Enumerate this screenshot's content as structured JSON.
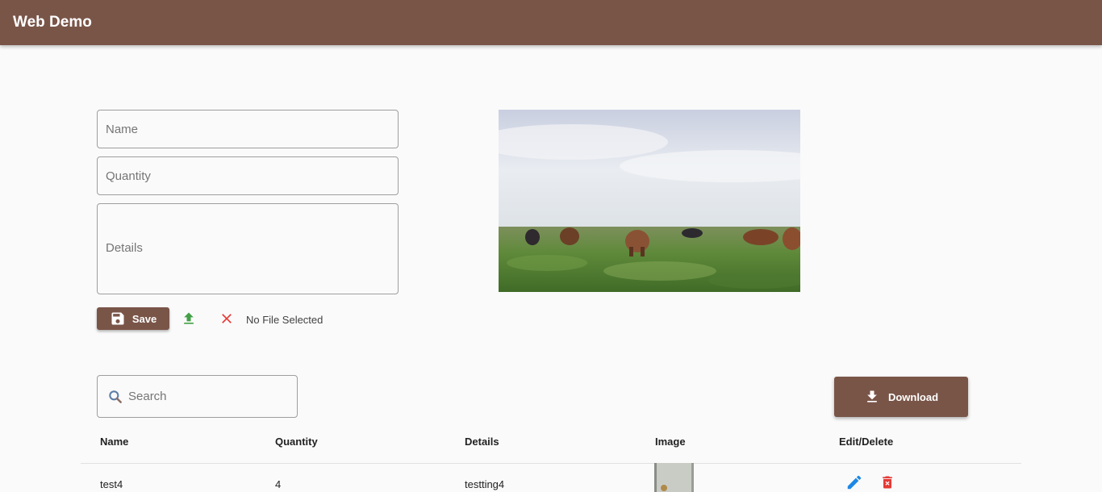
{
  "app": {
    "title": "Web Demo"
  },
  "form": {
    "name_placeholder": "Name",
    "quantity_placeholder": "Quantity",
    "details_placeholder": "Details",
    "save_label": "Save",
    "file_status": "No File Selected"
  },
  "search": {
    "placeholder": "Search"
  },
  "download_label": "Download",
  "table": {
    "headers": [
      "Name",
      "Quantity",
      "Details",
      "Image",
      "Edit/Delete"
    ],
    "rows": [
      {
        "name": "test4",
        "quantity": "4",
        "details": "testting4"
      }
    ]
  },
  "icons": {
    "save": "floppy-disk-icon",
    "upload": "upload-icon",
    "clear": "close-icon",
    "search": "search-icon",
    "download": "download-icon",
    "edit": "pencil-icon",
    "delete": "trash-icon"
  },
  "colors": {
    "primary": "#795548",
    "upload": "#43a047",
    "clear": "#e53935",
    "edit": "#1e88e5",
    "delete": "#e53935"
  }
}
